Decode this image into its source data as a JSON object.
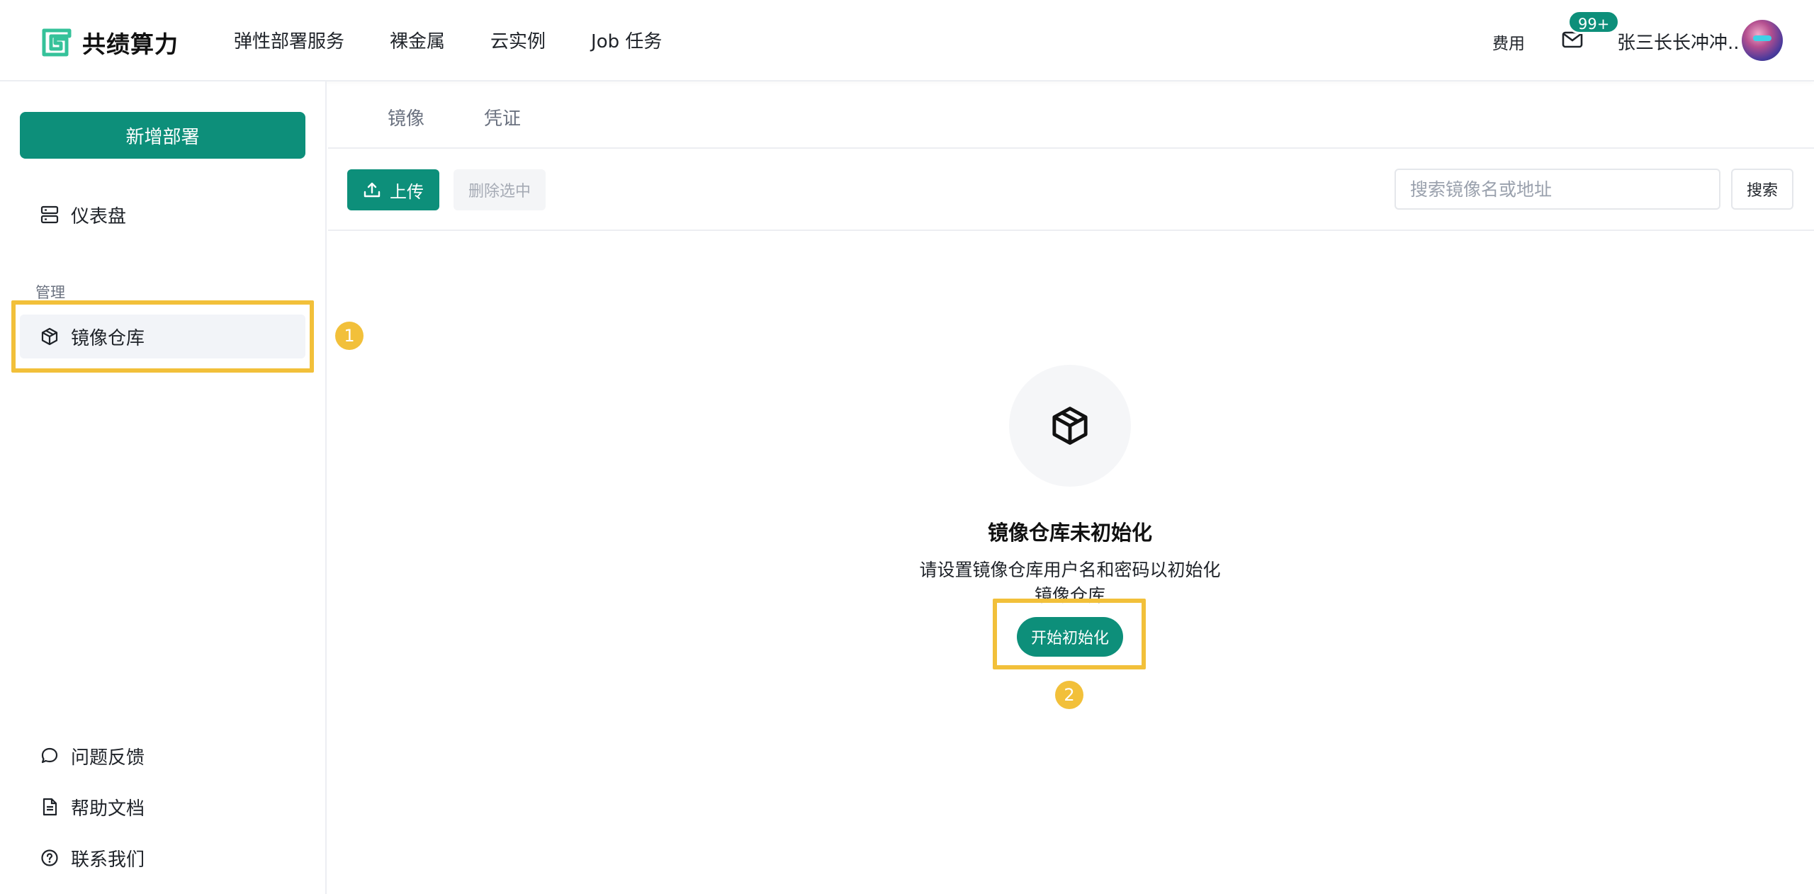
{
  "brand": {
    "name": "共绩算力"
  },
  "topnav": {
    "items": [
      "弹性部署服务",
      "裸金属",
      "云实例",
      "Job 任务"
    ]
  },
  "header": {
    "fee": "费用",
    "mail_badge": "99+",
    "username": "张三长长冲冲.."
  },
  "sidebar": {
    "new_deploy": "新增部署",
    "dashboard": "仪表盘",
    "section_manage": "管理",
    "registry": "镜像仓库",
    "feedback": "问题反馈",
    "help": "帮助文档",
    "contact": "联系我们"
  },
  "tabs": [
    "镜像",
    "凭证"
  ],
  "toolbar": {
    "upload": "上传",
    "delete_selected": "删除选中",
    "search_placeholder": "搜索镜像名或地址",
    "search": "搜索"
  },
  "empty_state": {
    "title": "镜像仓库未初始化",
    "description": "请设置镜像仓库用户名和密码以初始化镜像仓库",
    "init_button": "开始初始化"
  },
  "annotations": {
    "step1": "1",
    "step2": "2"
  },
  "colors": {
    "brand": "#0d8f7a",
    "highlight": "#f2c03a"
  }
}
